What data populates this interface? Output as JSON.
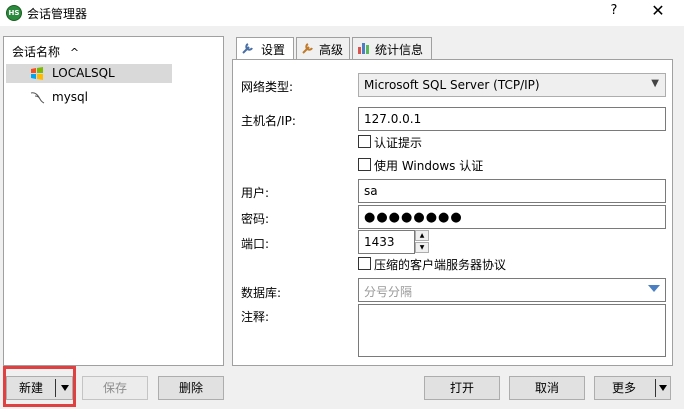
{
  "window": {
    "title": "会话管理器",
    "app_icon_text": "HS",
    "help_label": "?",
    "close_label": "✕"
  },
  "sidebar": {
    "header": "会话名称",
    "sort_icon": "^",
    "items": [
      {
        "label": "LOCALSQL",
        "selected": true,
        "icon": "mssql-icon"
      },
      {
        "label": "mysql",
        "selected": false,
        "icon": "mysql-dolphin-icon"
      }
    ]
  },
  "tabs": [
    {
      "label": "设置",
      "icon": "wrench-icon",
      "active": true
    },
    {
      "label": "高级",
      "icon": "wrench-icon",
      "active": false
    },
    {
      "label": "统计信息",
      "icon": "bar-chart-icon",
      "active": false
    }
  ],
  "form": {
    "network_type_label": "网络类型:",
    "network_type_value": "Microsoft SQL Server (TCP/IP)",
    "host_label": "主机名/IP:",
    "host_value": "127.0.0.1",
    "auth_prompt_label": "认证提示",
    "windows_auth_label": "使用 Windows 认证",
    "user_label": "用户:",
    "user_value": "sa",
    "password_label": "密码:",
    "password_value": "●●●●●●●●",
    "port_label": "端口:",
    "port_value": "1433",
    "compress_label": "压缩的客户端服务器协议",
    "database_label": "数据库:",
    "database_placeholder": "分号分隔",
    "comment_label": "注释:"
  },
  "buttons": {
    "new": "新建",
    "save": "保存",
    "delete": "删除",
    "open": "打开",
    "cancel": "取消",
    "more": "更多"
  },
  "colors": {
    "highlight": "#e04040",
    "selection": "#d9d9d9"
  }
}
